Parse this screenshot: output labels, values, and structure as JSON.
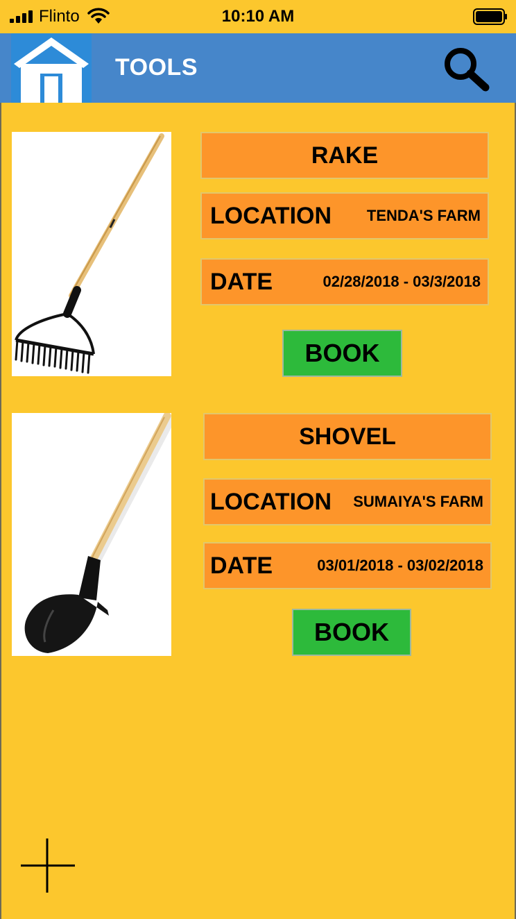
{
  "status_bar": {
    "carrier": "Flinto",
    "time": "10:10 AM"
  },
  "header": {
    "title": "TOOLS",
    "home_icon": "home-icon",
    "search_icon": "search-icon"
  },
  "tools": [
    {
      "name": "RAKE",
      "location_label": "LOCATION",
      "location": "TENDA'S FARM",
      "date_label": "DATE",
      "date": "02/28/2018 - 03/3/2018",
      "book_label": "BOOK",
      "image": "rake-image"
    },
    {
      "name": "SHOVEL",
      "location_label": "LOCATION",
      "location": "SUMAIYA'S FARM",
      "date_label": "DATE",
      "date": "03/01/2018 - 03/02/2018",
      "book_label": "BOOK",
      "image": "shovel-image"
    }
  ],
  "fab": {
    "icon": "plus-icon"
  },
  "colors": {
    "background": "#FCC72D",
    "header": "#4686CA",
    "orange": "#FD952A",
    "green": "#2DBA3B"
  }
}
